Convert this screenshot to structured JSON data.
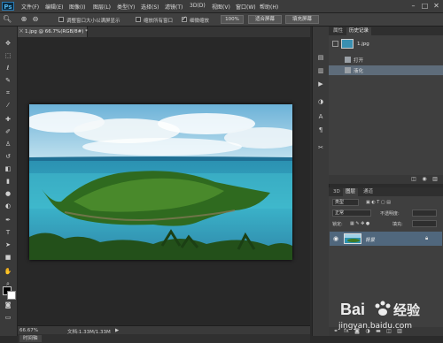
{
  "app": {
    "logo": "Ps",
    "menu": [
      "文件(F)",
      "编辑(E)",
      "图像(I)",
      "图层(L)",
      "类型(Y)",
      "选择(S)",
      "滤镜(T)",
      "3D(D)",
      "视图(V)",
      "窗口(W)",
      "帮助(H)"
    ],
    "window_controls": {
      "minimize": "–",
      "maximize": "□",
      "close": "✕"
    }
  },
  "options_bar": {
    "resize_windows_label": "调整窗口大小以满屏显示",
    "resize_windows_checked": false,
    "zoom_all_label": "缩放所有窗口",
    "zoom_all_checked": false,
    "scrubby_zoom_label": "细微缩放",
    "scrubby_zoom_checked": true,
    "btn_100": "100%",
    "btn_fit": "适合屏幕",
    "btn_fill": "填充屏幕"
  },
  "document": {
    "tab_label": "1.jpg @ 66.7%(RGB/8#) *",
    "close_glyph": "×"
  },
  "status": {
    "zoom": "66.67%",
    "doc_info": "文档:1.33M/1.33M",
    "arrow": "▶"
  },
  "bottom": {
    "timeline_tab": "时间轴"
  },
  "history_panel": {
    "tabs": [
      "属性",
      "历史记录"
    ],
    "active_tab": 1,
    "snapshot_label": "1.jpg",
    "items": [
      {
        "label": "打开"
      },
      {
        "label": "液化"
      }
    ],
    "selected_item": 1
  },
  "layers_panel": {
    "tabs": [
      "3D",
      "图层",
      "通道"
    ],
    "active_tab": 1,
    "kind_label": "类型",
    "blend_mode": "正常",
    "opacity_label": "不透明度:",
    "lock_label": "锁定:",
    "fill_label": "填充:",
    "layers": [
      {
        "name": "背景",
        "visible": true,
        "locked": true
      }
    ]
  },
  "watermark": {
    "brand": "Bai",
    "brand_suffix": "经验",
    "url": "jingyan.baidu.com"
  },
  "colors": {
    "ui_dark": "#2b2b2b",
    "panel": "#3f3f3f",
    "selection": "#50677d",
    "accent": "#4fb0e6"
  }
}
